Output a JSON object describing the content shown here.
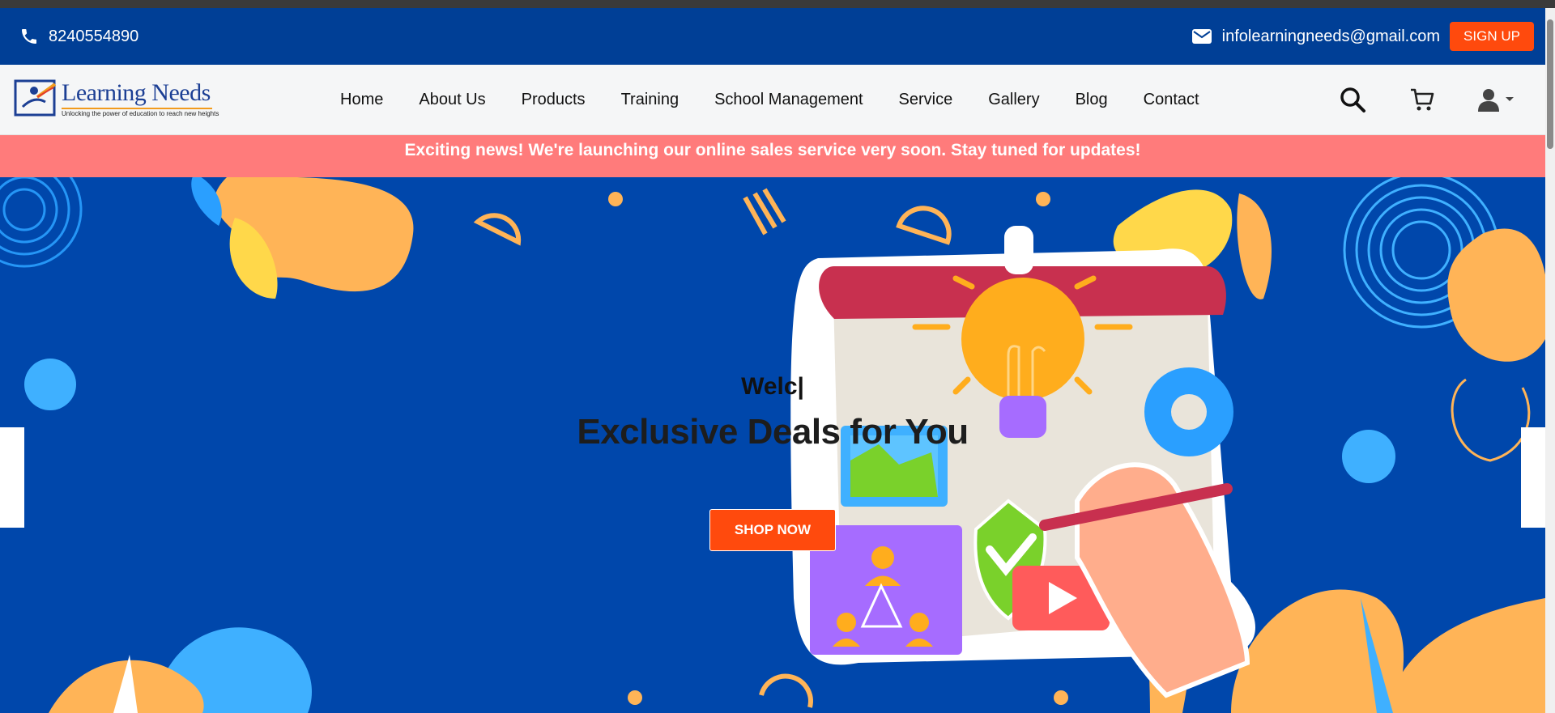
{
  "topbar": {
    "phone": "8240554890",
    "email": "infolearningneeds@gmail.com",
    "signup_label": "SIGN UP"
  },
  "logo": {
    "name": "Learning Needs",
    "tagline": "Unlocking the power of education to reach new heights"
  },
  "nav": {
    "items": [
      {
        "label": "Home"
      },
      {
        "label": "About Us"
      },
      {
        "label": "Products"
      },
      {
        "label": "Training"
      },
      {
        "label": "School Management"
      },
      {
        "label": "Service"
      },
      {
        "label": "Gallery"
      },
      {
        "label": "Blog"
      },
      {
        "label": "Contact"
      }
    ],
    "icons": [
      "search-icon",
      "cart-icon",
      "user-icon",
      "caret-down-icon"
    ]
  },
  "announcement": {
    "text": "Exciting news! We're launching our online sales service very soon. Stay tuned for updates!"
  },
  "hero": {
    "welcome": "Welc|",
    "title": "Exclusive Deals for You",
    "cta_label": "SHOP NOW"
  },
  "colors": {
    "topbar": "#003f96",
    "hero_bg": "#0047ab",
    "accent": "#ff4a0d",
    "announcement_bg": "#ff7b7b"
  }
}
